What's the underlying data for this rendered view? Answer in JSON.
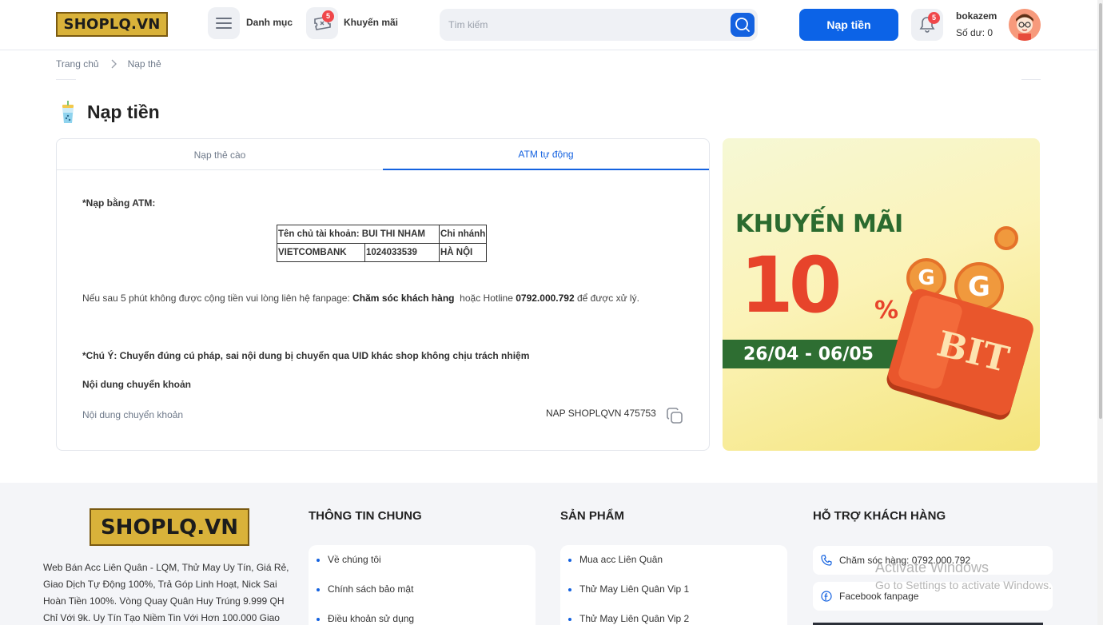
{
  "header": {
    "logo_text": "SHOPLQ.VN",
    "menu_label": "Danh mục",
    "promo_label": "Khuyến mãi",
    "promo_badge": "5",
    "search_placeholder": "Tìm kiếm",
    "deposit_label": "Nạp tiền",
    "notification_badge": "5",
    "username": "bokazem",
    "balance": "Số dư: 0",
    "accent_color": "#0c63e7"
  },
  "breadcrumb": {
    "home": "Trang chủ",
    "current": "Nạp thẻ"
  },
  "page": {
    "title": "Nạp tiền"
  },
  "tabs": [
    {
      "label": "Nạp thẻ cào",
      "active": false
    },
    {
      "label": "ATM tự động",
      "active": true
    }
  ],
  "atm": {
    "heading": "*Nạp bằng ATM:",
    "table": {
      "row1": [
        "Tên chủ tài khoản: BUI THI NHAM",
        "Chi nhánh"
      ],
      "row2": [
        "VIETCOMBANK",
        "1024033539",
        "HÀ NỘI"
      ]
    },
    "note_prefix": "Nếu sau 5 phút không được cộng tiền vui lòng liên hệ fanpage: ",
    "note_fanpage": "Chăm sóc khách hàng",
    "note_middle": "  hoặc Hotline ",
    "note_hotline": "0792.000.792",
    "note_suffix": " để được xử lý.",
    "warning": "*Chú Ý: Chuyển đúng cú pháp, sai nội dung bị chuyển qua UID khác shop không chịu trách nhiệm",
    "content_heading": "Nội dung chuyển khoản",
    "content_label": "Nội dung chuyển khoản",
    "content_value": "NAP SHOPLQVN 475753"
  },
  "banner": {
    "title": "KHUYẾN MÃI",
    "percent": "10",
    "percent_sign": "%",
    "dates": "26/04 - 06/05",
    "wallet_text": "BIT",
    "coin_letter": "G"
  },
  "footer": {
    "logo_text": "SHOPLQ.VN",
    "description": "Web Bán Acc Liên Quân - LQM, Thử May Uy Tín, Giá Rẻ, Giao Dịch Tự Động 100%, Trả Góp Linh Hoạt, Nick Sai Hoàn Tiền 100%. Vòng Quay Quân Huy Trúng 9.999 QH Chỉ Với 9k. Uy Tín Tạo Niềm Tin Với Hơn 100.000 Giao",
    "general_heading": "THÔNG TIN CHUNG",
    "general_links": [
      "Về chúng tôi",
      "Chính sách bảo mật",
      "Điều khoản sử dụng"
    ],
    "products_heading": "SẢN PHẨM",
    "product_links": [
      "Mua acc Liên Quân",
      "Thử May Liên Quân Vip 1",
      "Thử May Liên Quân Vip 2"
    ],
    "support_heading": "HỖ TRỢ KHÁCH HÀNG",
    "support_phone": "Chăm sóc hàng: 0792.000.792",
    "support_facebook": "Facebook fanpage"
  },
  "watermark": {
    "line1": "Activate Windows",
    "line2": "Go to Settings to activate Windows."
  }
}
